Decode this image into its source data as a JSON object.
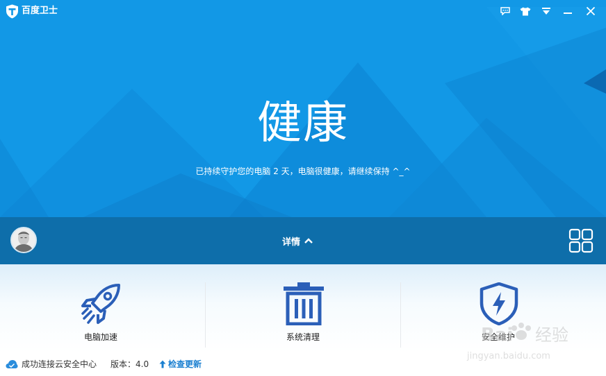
{
  "app": {
    "title": "百度卫士"
  },
  "titlebar": {
    "buttons": [
      {
        "icon": "feedback-icon"
      },
      {
        "icon": "skin-icon"
      },
      {
        "icon": "menu-icon"
      },
      {
        "icon": "minimize-icon"
      },
      {
        "icon": "close-icon"
      }
    ]
  },
  "status": {
    "headline": "健康",
    "subtext": "已持续守护您的电脑 2 天，电脑很健康，请继续保持 ^_^"
  },
  "details": {
    "label": "详情"
  },
  "tools": [
    {
      "label": "电脑加速",
      "icon": "rocket-icon"
    },
    {
      "label": "系统清理",
      "icon": "trash-icon"
    },
    {
      "label": "安全维护",
      "icon": "shield-icon"
    }
  ],
  "statusbar": {
    "connection": "成功连接云安全中心",
    "version": "版本：4.0",
    "update": "检查更新"
  },
  "watermark": {
    "brand": "Bai",
    "brand_suffix": "经验",
    "url": "jingyan.baidu.com"
  },
  "colors": {
    "hero": "#1298e6",
    "midbar": "#0e6eaa",
    "icon_blue": "#2b5fb8",
    "link_blue": "#1a7fd0"
  }
}
